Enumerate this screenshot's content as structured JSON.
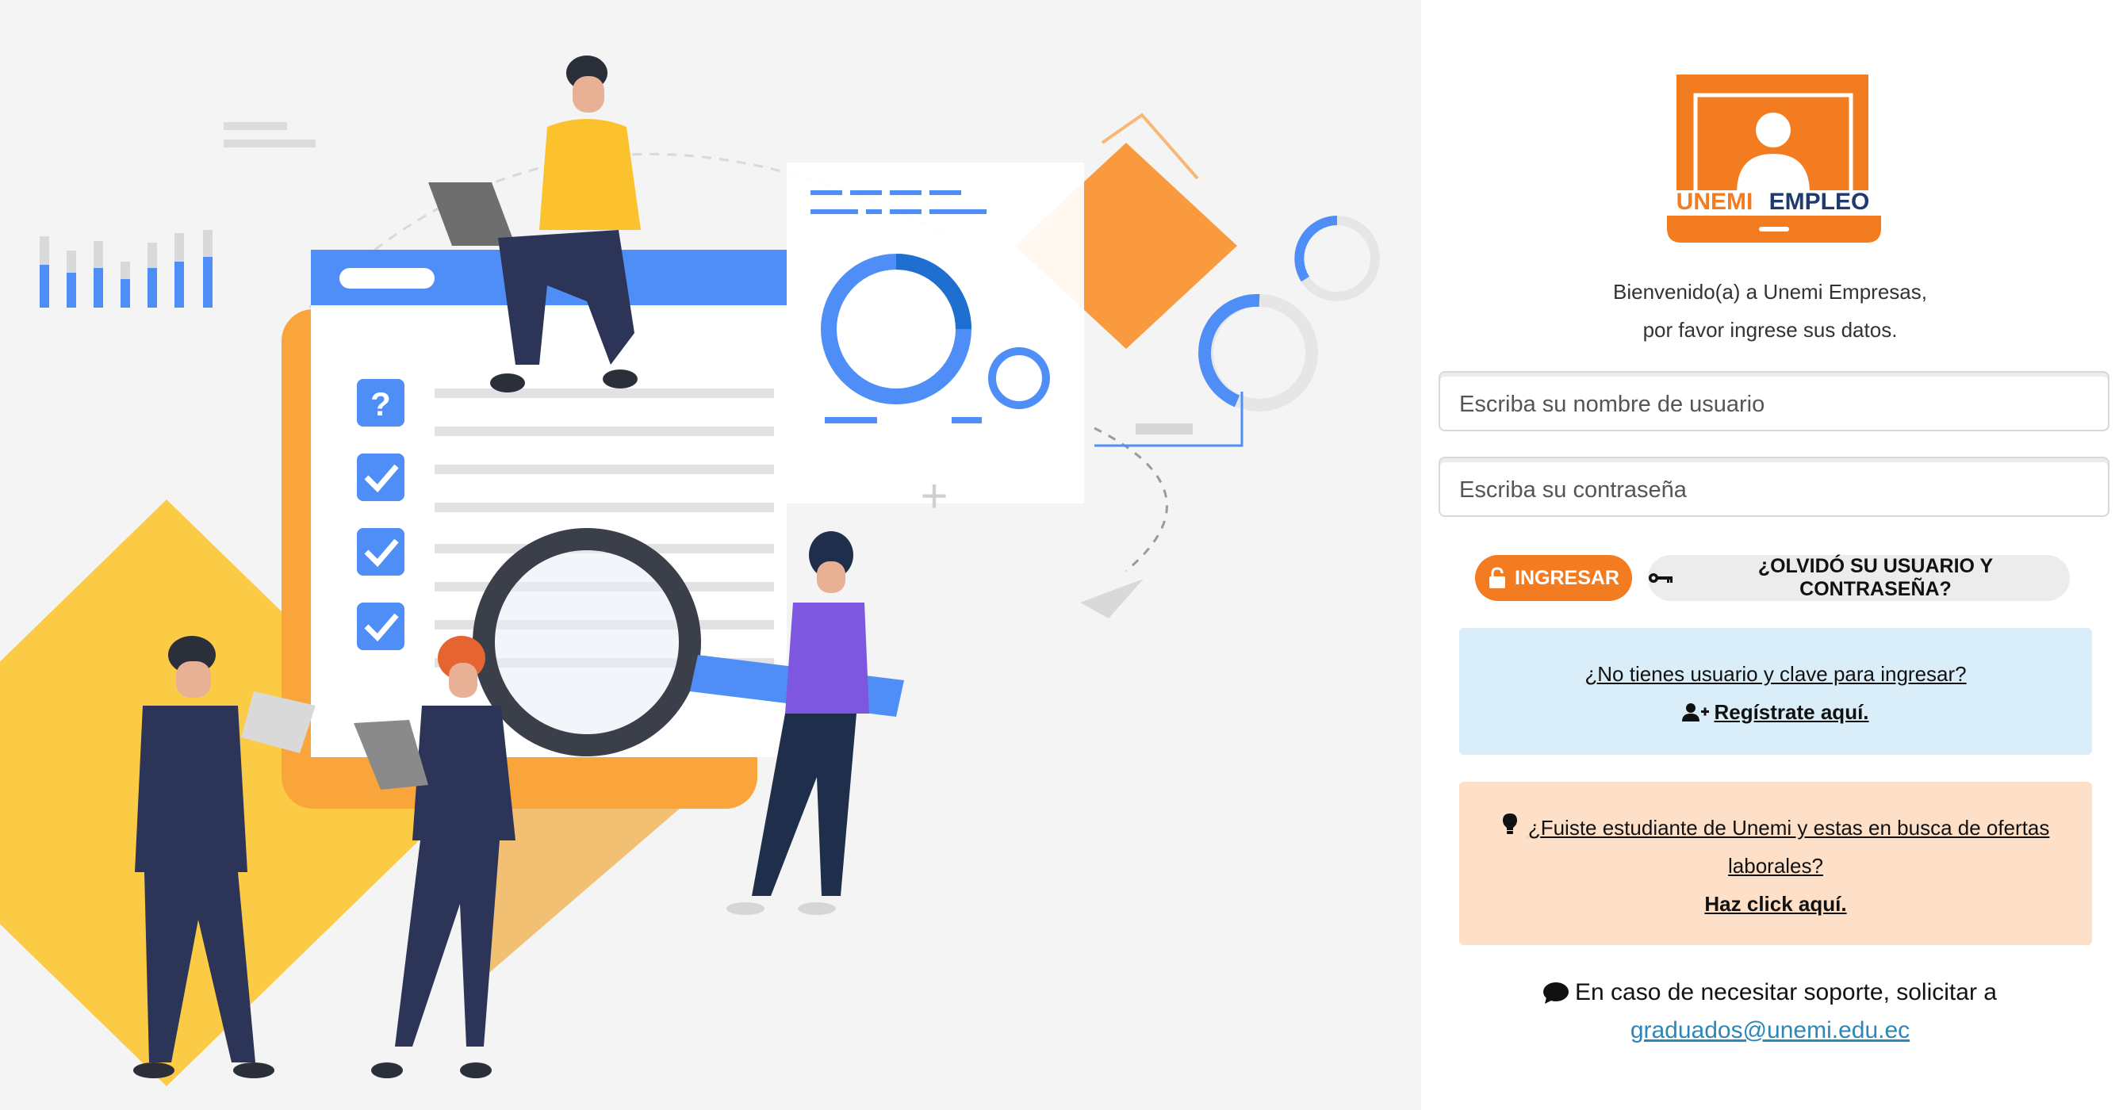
{
  "brand": {
    "name_part1": "UNEMI",
    "name_part2": "EMPLEO",
    "color_orange": "#f47c20",
    "color_navy": "#1f3a6e"
  },
  "welcome": {
    "line1": "Bienvenido(a) a Unemi Empresas,",
    "line2": "por favor ingrese sus datos."
  },
  "form": {
    "username_placeholder": "Escriba su nombre de usuario",
    "password_placeholder": "Escriba su contraseña",
    "login_label": "INGRESAR",
    "forgot_label": "¿OLVIDÓ SU USUARIO Y CONTRASEÑA?"
  },
  "register_box": {
    "question": "¿No tienes usuario y clave para ingresar?",
    "link": " Regístrate aquí."
  },
  "student_box": {
    "question": "¿Fuiste estudiante de Unemi y estas en busca de ofertas laborales?",
    "link": "Haz click aquí."
  },
  "support": {
    "text": "En caso de necesitar soporte, solicitar a",
    "email": "graduados@unemi.edu.ec"
  },
  "icons": {
    "login": "unlock-icon",
    "forgot": "key-icon",
    "register": "user-plus-icon",
    "student": "lightbulb-icon",
    "support": "comment-icon"
  },
  "colors": {
    "blue_box": "#d9eef8",
    "peach_box": "#fde0c7",
    "link_blue": "#2c86b8"
  }
}
